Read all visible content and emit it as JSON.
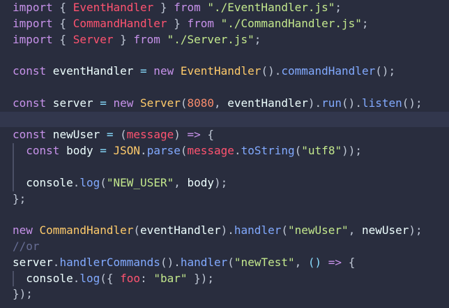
{
  "editor": {
    "language": "javascript",
    "colors": {
      "background": "#292d3e",
      "active_line": "#32374d",
      "keyword": "#c792ea",
      "class": "#ffcb6b",
      "variable": "#eeffff",
      "function": "#82aaff",
      "string": "#c3e88d",
      "number": "#f78c6c",
      "param": "#ff5370",
      "operator": "#89ddff",
      "punct": "#bfc7d5",
      "comment": "#676e95"
    },
    "lines": [
      [
        [
          "keyword",
          "import"
        ],
        [
          "punct",
          " { "
        ],
        [
          "param",
          "EventHandler"
        ],
        [
          "punct",
          " } "
        ],
        [
          "keyword",
          "from"
        ],
        [
          "string",
          " \"./EventHandler.js\""
        ],
        [
          "punct",
          ";"
        ]
      ],
      [
        [
          "keyword",
          "import"
        ],
        [
          "punct",
          " { "
        ],
        [
          "param",
          "CommandHandler"
        ],
        [
          "punct",
          " } "
        ],
        [
          "keyword",
          "from"
        ],
        [
          "string",
          " \"./CommandHandler.js\""
        ],
        [
          "punct",
          ";"
        ]
      ],
      [
        [
          "keyword",
          "import"
        ],
        [
          "punct",
          " { "
        ],
        [
          "param",
          "Server"
        ],
        [
          "punct",
          " } "
        ],
        [
          "keyword",
          "from"
        ],
        [
          "string",
          " \"./Server.js\""
        ],
        [
          "punct",
          ";"
        ]
      ],
      [],
      [
        [
          "keyword",
          "const"
        ],
        [
          "variable",
          " eventHandler "
        ],
        [
          "operator",
          "="
        ],
        [
          "keyword",
          " new "
        ],
        [
          "class",
          "EventHandler"
        ],
        [
          "punct",
          "()."
        ],
        [
          "function",
          "commandHandler"
        ],
        [
          "punct",
          "();"
        ]
      ],
      [],
      [
        [
          "keyword",
          "const"
        ],
        [
          "variable",
          " server "
        ],
        [
          "operator",
          "="
        ],
        [
          "keyword",
          " new "
        ],
        [
          "class",
          "Server"
        ],
        [
          "punct",
          "("
        ],
        [
          "number",
          "8080"
        ],
        [
          "punct",
          ", "
        ],
        [
          "variable",
          "eventHandler"
        ],
        [
          "punct",
          ")."
        ],
        [
          "function",
          "run"
        ],
        [
          "punct",
          "()."
        ],
        [
          "function",
          "listen"
        ],
        [
          "punct",
          "();"
        ]
      ],
      [],
      [
        [
          "keyword",
          "const"
        ],
        [
          "variable",
          " newUser "
        ],
        [
          "operator",
          "="
        ],
        [
          "punct",
          " ("
        ],
        [
          "param",
          "message"
        ],
        [
          "punct",
          ") "
        ],
        [
          "keyword",
          "=>"
        ],
        [
          "punct",
          " {"
        ]
      ],
      [
        [
          "keyword",
          "  const"
        ],
        [
          "variable",
          " body "
        ],
        [
          "operator",
          "="
        ],
        [
          "class",
          " JSON"
        ],
        [
          "punct",
          "."
        ],
        [
          "function",
          "parse"
        ],
        [
          "punct",
          "("
        ],
        [
          "param",
          "message"
        ],
        [
          "punct",
          "."
        ],
        [
          "function",
          "toString"
        ],
        [
          "punct",
          "("
        ],
        [
          "string",
          "\"utf8\""
        ],
        [
          "punct",
          "));"
        ]
      ],
      [],
      [
        [
          "variable",
          "  console"
        ],
        [
          "punct",
          "."
        ],
        [
          "function",
          "log"
        ],
        [
          "punct",
          "("
        ],
        [
          "string",
          "\"NEW_USER\""
        ],
        [
          "punct",
          ", "
        ],
        [
          "variable",
          "body"
        ],
        [
          "punct",
          ");"
        ]
      ],
      [
        [
          "punct",
          "};"
        ]
      ],
      [],
      [
        [
          "keyword",
          "new"
        ],
        [
          "class",
          " CommandHandler"
        ],
        [
          "punct",
          "("
        ],
        [
          "variable",
          "eventHandler"
        ],
        [
          "punct",
          ")."
        ],
        [
          "function",
          "handler"
        ],
        [
          "punct",
          "("
        ],
        [
          "string",
          "\"newUser\""
        ],
        [
          "punct",
          ", "
        ],
        [
          "variable",
          "newUser"
        ],
        [
          "punct",
          ");"
        ]
      ],
      [
        [
          "comment",
          "//or"
        ]
      ],
      [
        [
          "variable",
          "server"
        ],
        [
          "punct",
          "."
        ],
        [
          "function",
          "handlerCommands"
        ],
        [
          "punct",
          "()."
        ],
        [
          "function",
          "handler"
        ],
        [
          "punct",
          "("
        ],
        [
          "string",
          "\"newTest\""
        ],
        [
          "punct",
          ", "
        ],
        [
          "operator",
          "()"
        ],
        [
          "keyword",
          " =>"
        ],
        [
          "punct",
          " {"
        ]
      ],
      [
        [
          "variable",
          "  console"
        ],
        [
          "punct",
          "."
        ],
        [
          "function",
          "log"
        ],
        [
          "punct",
          "({ "
        ],
        [
          "param",
          "foo"
        ],
        [
          "punct",
          ": "
        ],
        [
          "string",
          "\"bar\""
        ],
        [
          "punct",
          " });"
        ]
      ],
      [
        [
          "punct",
          "});"
        ]
      ]
    ]
  }
}
